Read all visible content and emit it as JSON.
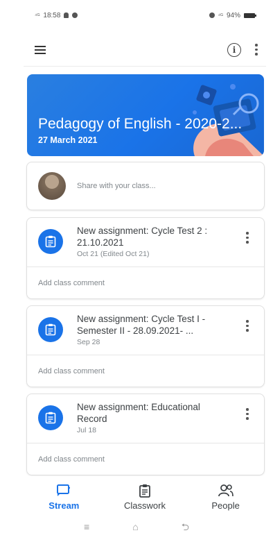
{
  "status_bar": {
    "signal": "⁴ᴳ",
    "time": "18:58",
    "network": "⁴ᴳ",
    "battery": "94%"
  },
  "app_bar": {
    "menu_icon": "menu-icon",
    "info_icon": "info-icon",
    "more_icon": "more-vert-icon"
  },
  "banner": {
    "title": "Pedagogy of English - 2020-2...",
    "date": "27 March 2021",
    "color": "#1a73e8"
  },
  "share": {
    "placeholder": "Share with your class..."
  },
  "posts": [
    {
      "title": "New assignment: Cycle Test 2 : 21.10.2021",
      "date": "Oct 21 (Edited Oct 21)",
      "comment_placeholder": "Add class comment"
    },
    {
      "title": "New assignment: Cycle Test I - Semester II - 28.09.2021- ...",
      "date": "Sep 28",
      "comment_placeholder": "Add class comment"
    },
    {
      "title": "New assignment: Educational Record",
      "date": "Jul 18",
      "comment_placeholder": "Add class comment"
    }
  ],
  "bottom_nav": {
    "items": [
      {
        "label": "Stream",
        "icon": "stream-icon",
        "active": true
      },
      {
        "label": "Classwork",
        "icon": "classwork-icon",
        "active": false
      },
      {
        "label": "People",
        "icon": "people-icon",
        "active": false
      }
    ]
  },
  "system_nav": {
    "menu": "≡",
    "home": "⌂",
    "back": "⮌"
  },
  "colors": {
    "accent": "#1a73e8",
    "text": "#3c4043",
    "muted": "#80868b"
  }
}
